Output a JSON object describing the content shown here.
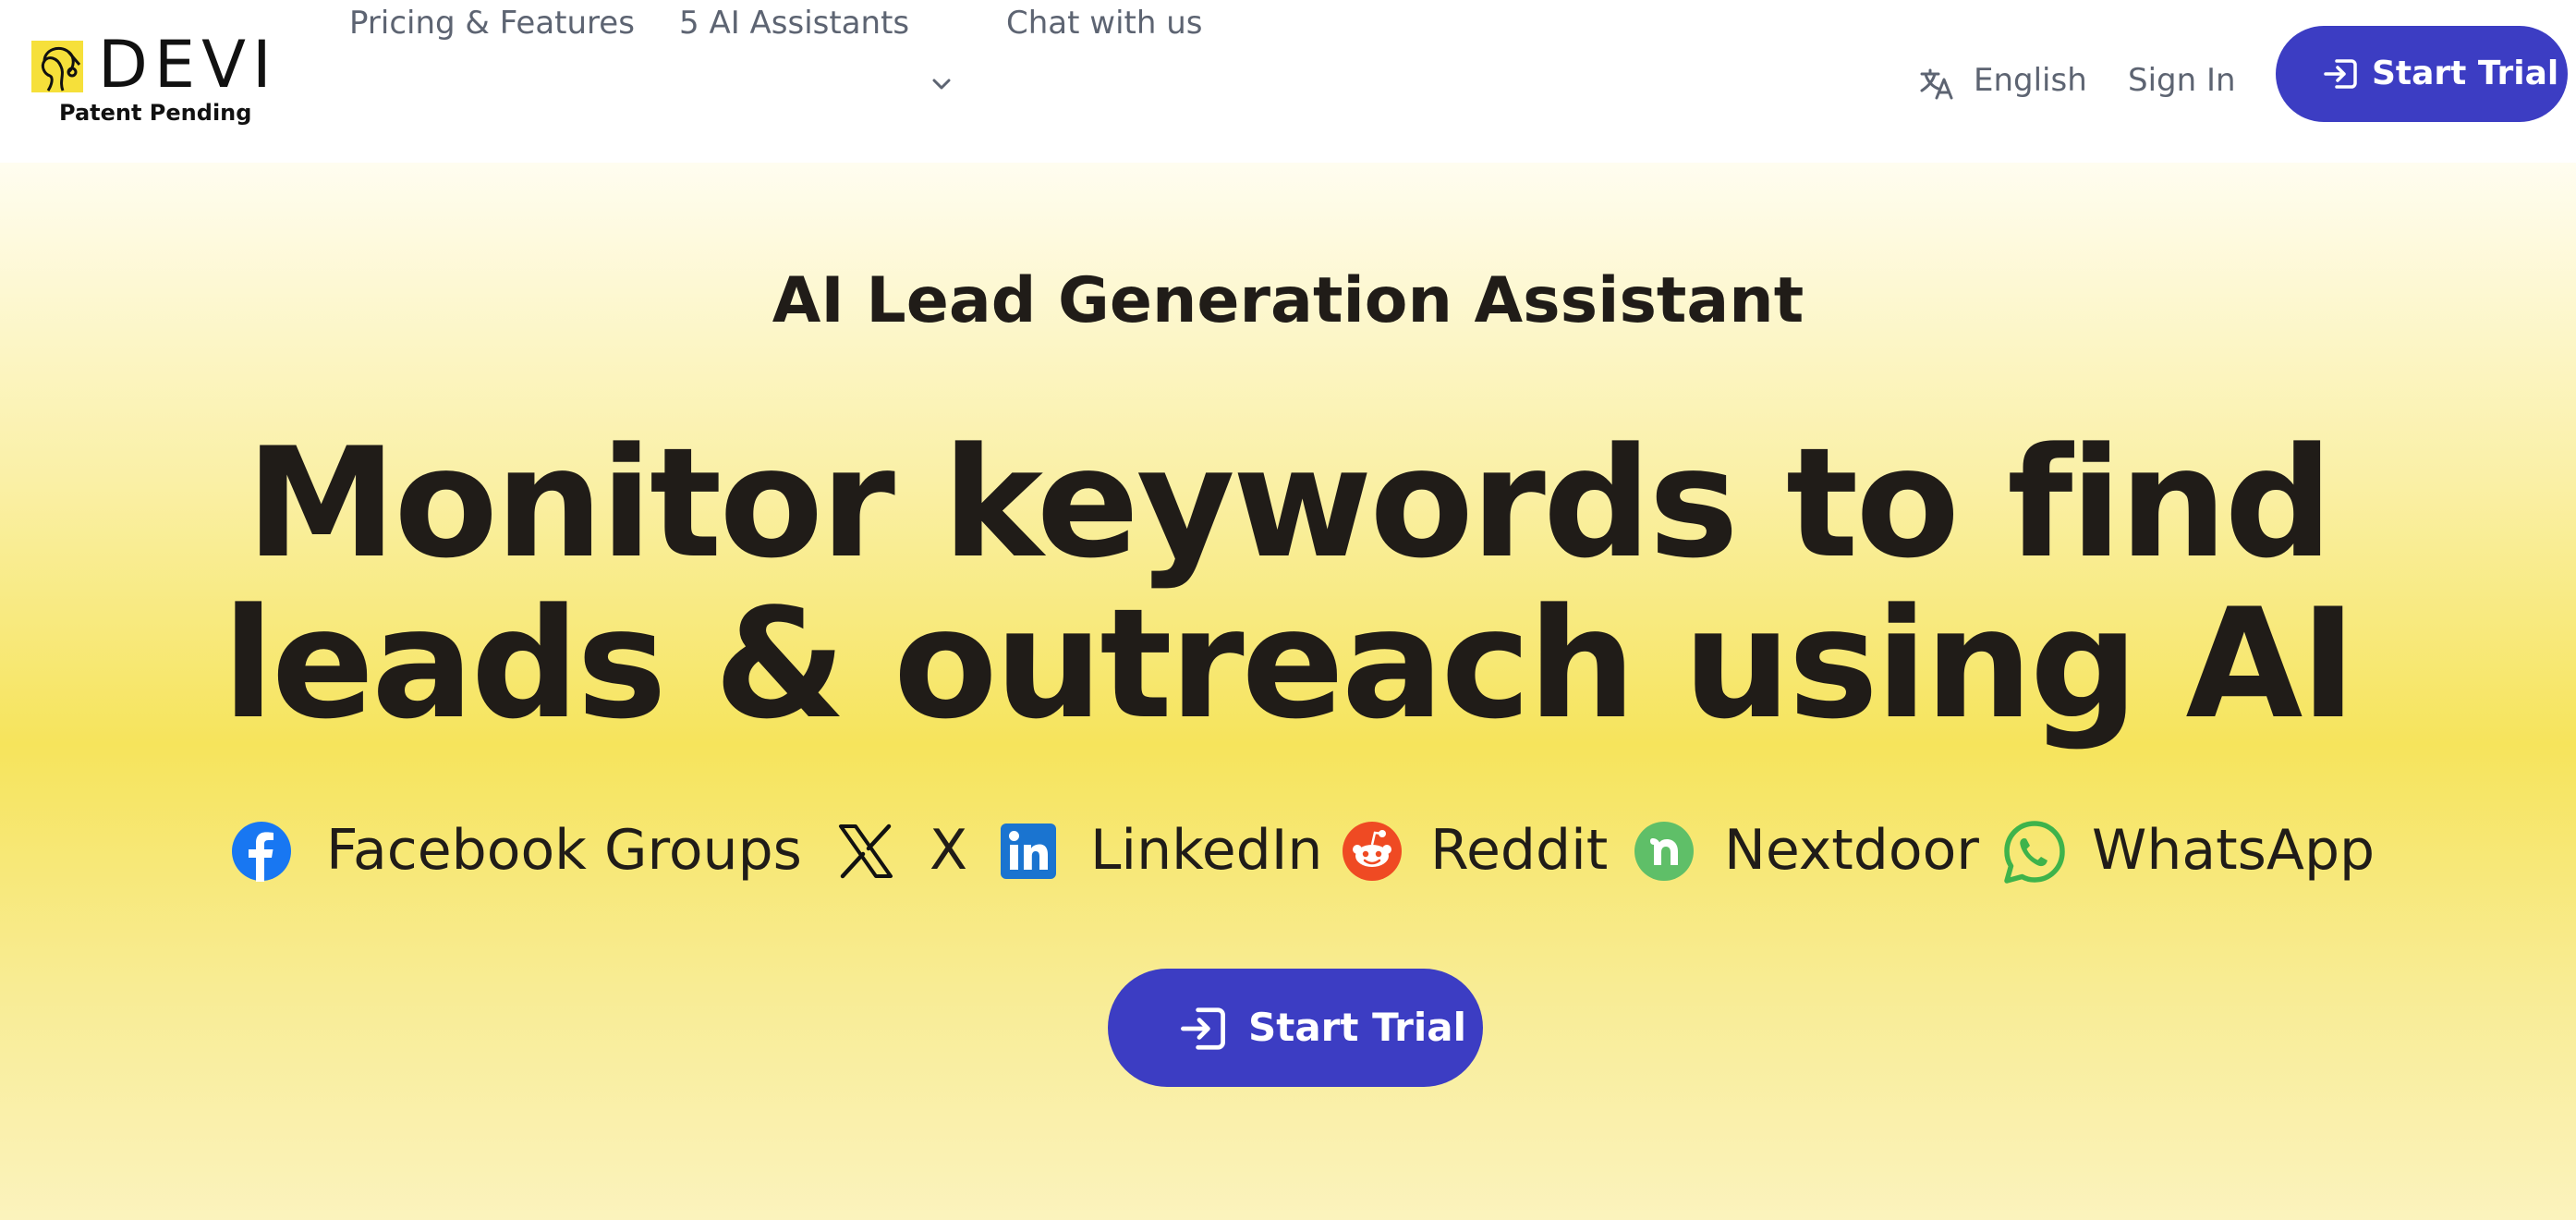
{
  "brand": {
    "name": "DEVI",
    "tagline": "Patent Pending"
  },
  "nav": {
    "pricing": "Pricing & Features",
    "assistants": "5 AI Assistants",
    "chat": "Chat with us",
    "language": "English",
    "sign_in": "Sign In",
    "start_trial": "Start Trial"
  },
  "hero": {
    "eyebrow": "AI Lead Generation Assistant",
    "headline_line1": "Monitor keywords to find",
    "headline_line2": "leads & outreach using AI",
    "cta": "Start Trial"
  },
  "platforms": [
    {
      "label": "Facebook Groups",
      "icon": "facebook-icon",
      "color": "#1877f2"
    },
    {
      "label": "X",
      "icon": "x-icon",
      "color": "#000000"
    },
    {
      "label": "LinkedIn",
      "icon": "linkedin-icon",
      "color": "#0a66c2"
    },
    {
      "label": "Reddit",
      "icon": "reddit-icon",
      "color": "#ff4500"
    },
    {
      "label": "Nextdoor",
      "icon": "nextdoor-icon",
      "color": "#60c25b"
    },
    {
      "label": "WhatsApp",
      "icon": "whatsapp-icon",
      "color": "#25d366"
    }
  ],
  "colors": {
    "accent": "#3c3dc3",
    "hero_yellow": "#f6e45c",
    "text_dark": "#201c18",
    "nav_text": "#5d6472"
  }
}
